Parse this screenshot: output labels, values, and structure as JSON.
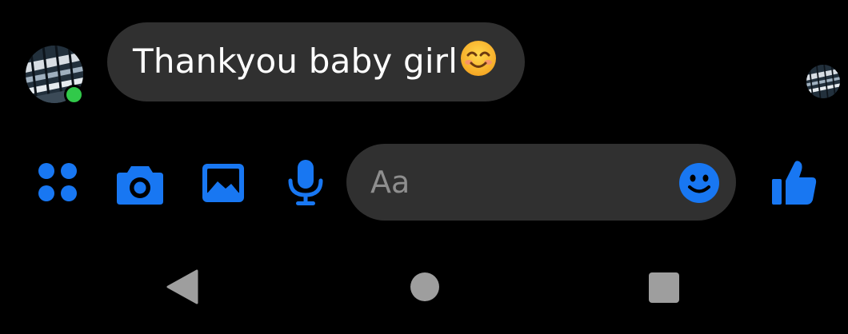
{
  "conversation": {
    "messages": [
      {
        "text": "Thankyou baby girl",
        "emoji": "smiling-face-icon"
      }
    ],
    "sender_online": true
  },
  "composer": {
    "placeholder": "Aa",
    "value": ""
  },
  "toolbar": {
    "icons": [
      "apps-icon",
      "camera-icon",
      "gallery-icon",
      "microphone-icon",
      "emoji-icon",
      "thumbs-up-icon"
    ]
  },
  "navigation": {
    "icons": [
      "back-triangle-icon",
      "home-circle-icon",
      "recents-square-icon"
    ]
  },
  "colors": {
    "background": "#000000",
    "bubble": "#303030",
    "accent": "#1877f2",
    "online": "#31c94a",
    "nav": "#9e9e9e",
    "placeholder": "#8e8e8e"
  }
}
